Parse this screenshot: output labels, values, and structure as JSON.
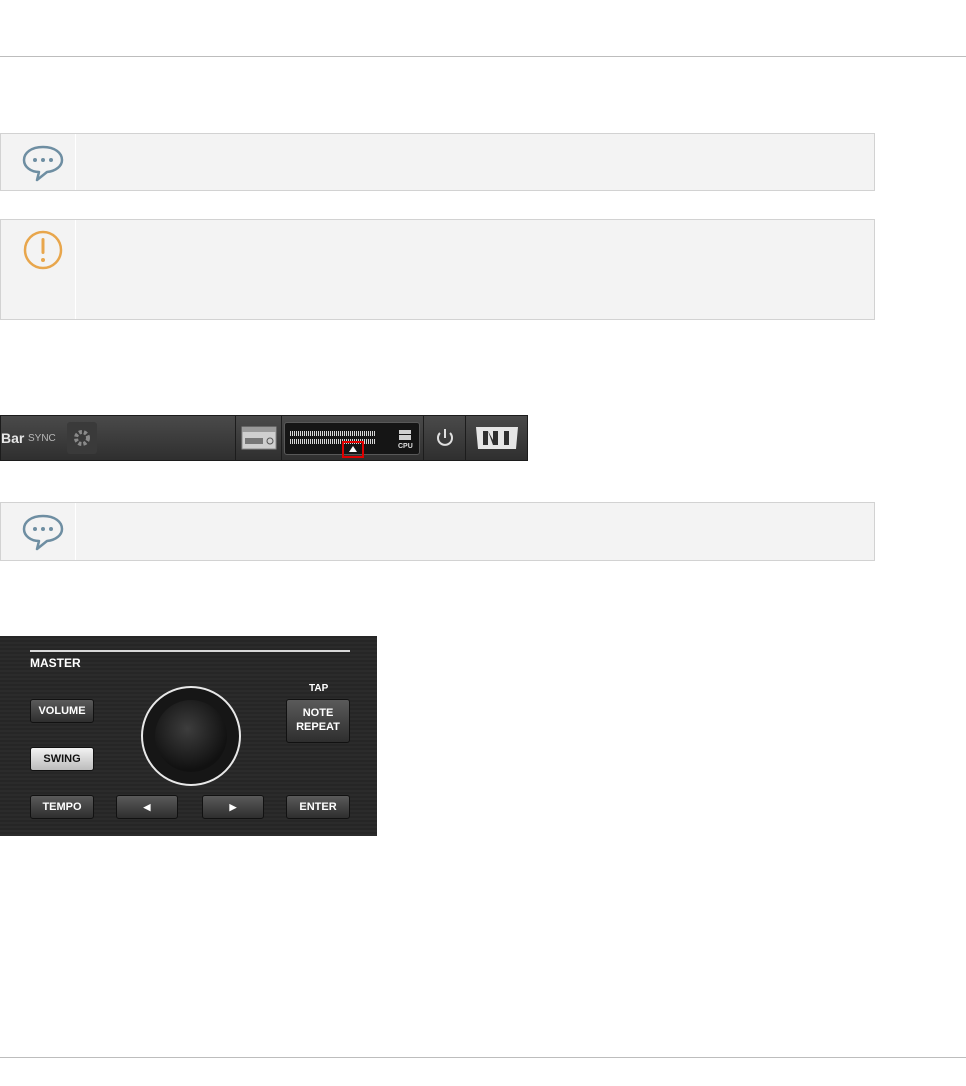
{
  "header_bar": {
    "bar_label": "Bar",
    "sync_label": "SYNC",
    "cpu_label": "CPU",
    "cpu_meter_level": 0.85
  },
  "controller": {
    "section_label": "MASTER",
    "tap_label": "TAP",
    "buttons": {
      "volume": "VOLUME",
      "swing": "SWING",
      "tempo": "TEMPO",
      "note_repeat_line1": "NOTE",
      "note_repeat_line2": "REPEAT",
      "left": "◀",
      "right": "▶",
      "enter": "ENTER"
    },
    "active_button": "swing"
  },
  "icons": [
    "speech-bubble-icon",
    "warning-icon",
    "gear-icon",
    "keyboard-icon",
    "power-icon",
    "ni-logo-icon",
    "arrow-up-icon"
  ],
  "colors": {
    "note_icon": "#6e8ea2",
    "warning_icon": "#e8a64c",
    "highlight": "#e00000"
  }
}
